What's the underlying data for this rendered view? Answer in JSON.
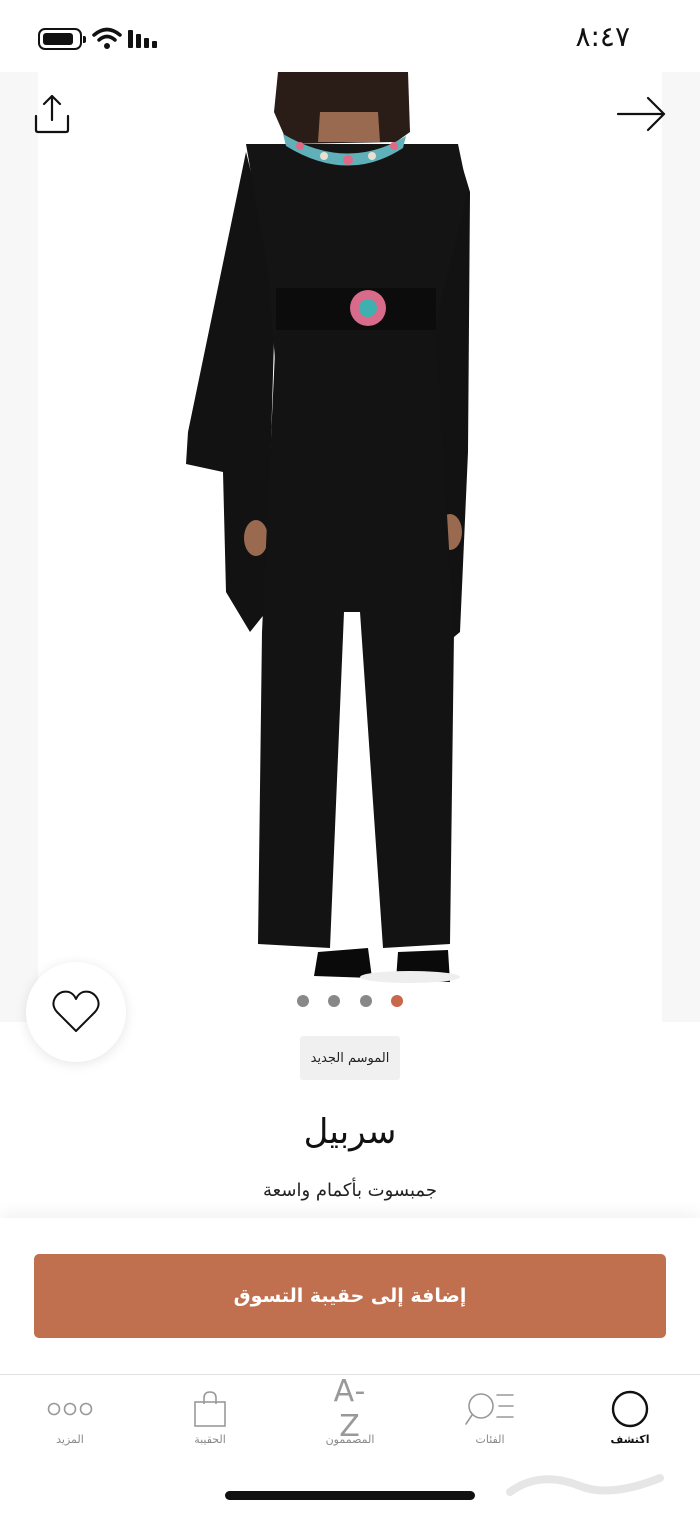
{
  "status_bar": {
    "time": "٨:٤٧"
  },
  "product": {
    "badge": "الموسم الجديد",
    "brand": "سربيل",
    "name": "جمبسوت بأكمام واسعة",
    "image_count": 4,
    "active_image_index": 3,
    "favorite": false
  },
  "actions": {
    "add_to_bag": "إضافة إلى حقيبة التسوق"
  },
  "tabbar": {
    "items": [
      {
        "label": "المزيد",
        "icon": "more-dots-icon"
      },
      {
        "label": "الحقيبة",
        "icon": "bag-icon"
      },
      {
        "label": "المصممون",
        "icon": "designers-az-icon",
        "glyph": "A-Z"
      },
      {
        "label": "الفئات",
        "icon": "categories-search-icon"
      },
      {
        "label": "اكتشف",
        "icon": "discover-circle-icon",
        "active": true
      }
    ]
  },
  "colors": {
    "accent": "#c0704f",
    "active_dot": "#c8674a",
    "garment": "#121212"
  },
  "icons": {
    "share": "share-icon",
    "back": "arrow-right-icon",
    "favorite": "heart-icon"
  }
}
